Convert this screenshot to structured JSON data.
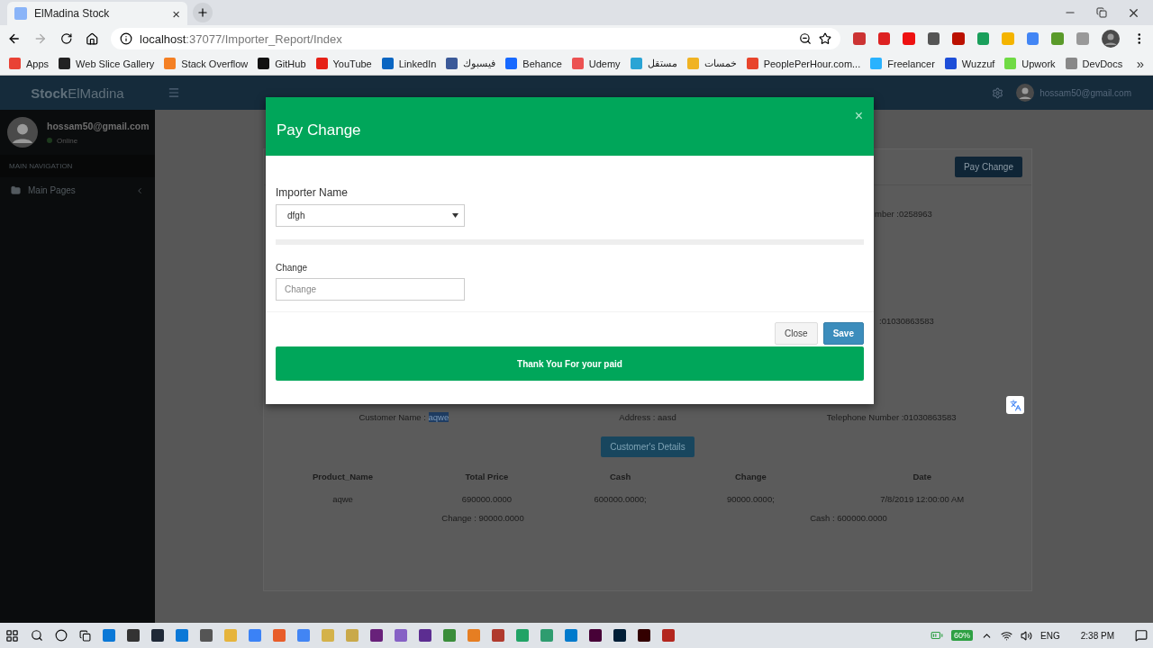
{
  "browser": {
    "tab": {
      "title": "ElMadina Stock",
      "close": "×"
    },
    "address": {
      "host": "localhost",
      "path": ":37077/Importer_Report/Index"
    },
    "bookmarks": [
      {
        "label": "Apps",
        "color": "#e94235"
      },
      {
        "label": "Web Slice Gallery",
        "color": "#222222"
      },
      {
        "label": "Stack Overflow",
        "color": "#f48024"
      },
      {
        "label": "GitHub",
        "color": "#111111"
      },
      {
        "label": "YouTube",
        "color": "#e62117"
      },
      {
        "label": "LinkedIn",
        "color": "#0a66c2"
      },
      {
        "label": "فيسبوك",
        "color": "#3b5998"
      },
      {
        "label": "Behance",
        "color": "#1769ff"
      },
      {
        "label": "Udemy",
        "color": "#ec5252"
      },
      {
        "label": "مستقل",
        "color": "#2aa4d5"
      },
      {
        "label": "خمسات",
        "color": "#f0b323"
      },
      {
        "label": "PeoplePerHour.com...",
        "color": "#e8452c"
      },
      {
        "label": "Freelancer",
        "color": "#29b2fe"
      },
      {
        "label": "Wuzzuf",
        "color": "#1d4ed8"
      },
      {
        "label": "Upwork",
        "color": "#6fda44"
      },
      {
        "label": "DevDocs",
        "color": "#888888"
      }
    ],
    "more_bookmarks": "»"
  },
  "app": {
    "logo": "**Stock**ElMadina",
    "user_email": "hossam50@gmail.com"
  },
  "sidebar": {
    "user": {
      "email": "hossam50@gmail.com",
      "status": "Online"
    },
    "section": "MAIN NAVIGATION",
    "items": [
      {
        "label": "Main Pages",
        "expanded": false
      }
    ]
  },
  "report": {
    "pay_button": "Pay Change",
    "partial_rows": [
      "mber :0258963",
      ":01030863583"
    ],
    "customer": {
      "name_label": "Customer Name : ",
      "name": "aqwe",
      "name_selected": true,
      "address": "Address : aasd",
      "telephone": "Telephone Number :01030863583"
    },
    "details_button": "Customer's Details",
    "table": {
      "columns": [
        "Product_Name",
        "Total Price",
        "Cash",
        "Change",
        "Date"
      ],
      "rows": [
        [
          "aqwe",
          "690000.0000",
          "600000.0000;",
          "90000.0000;",
          "7/8/2019 12:00:00 AM"
        ]
      ]
    },
    "summary": [
      "Change : 90000.0000",
      "Cash : 600000.0000"
    ]
  },
  "modal": {
    "title": "Pay Change",
    "close": "×",
    "importer_label": "Importer Name",
    "importer_value": "dfgh",
    "change_label": "Change",
    "change_placeholder": "Change",
    "buttons": [
      {
        "label": "Close",
        "kind": "default"
      },
      {
        "label": "Save",
        "kind": "primary"
      }
    ],
    "alert": "Thank You For your paid"
  },
  "taskbar": {
    "battery": "60%",
    "language": "ENG",
    "time": "2:38 PM"
  }
}
